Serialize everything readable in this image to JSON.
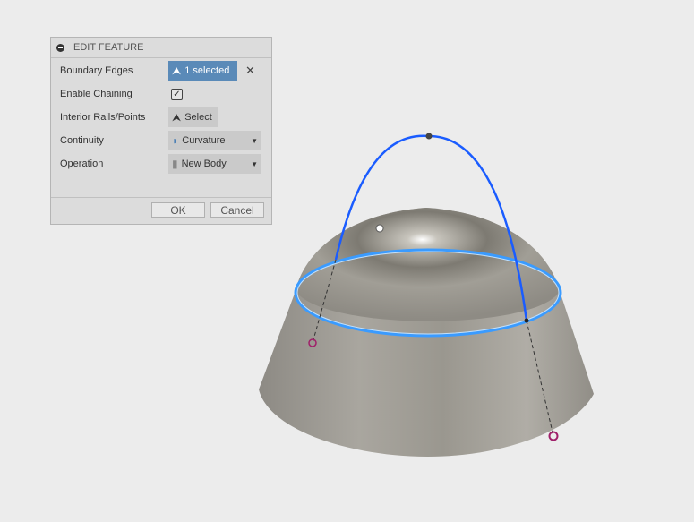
{
  "dialog": {
    "title": "EDIT FEATURE",
    "rows": [
      {
        "label": "Boundary Edges",
        "value": "1 selected"
      },
      {
        "label": "Enable Chaining",
        "checked": true,
        "check_glyph": "✓"
      },
      {
        "label": "Interior Rails/Points",
        "value": "Select"
      },
      {
        "label": "Continuity",
        "value": "Curvature"
      },
      {
        "label": "Operation",
        "value": "New Body"
      }
    ],
    "clear_glyph": "✕",
    "ok_label": "OK",
    "cancel_label": "Cancel"
  },
  "colors": {
    "accent": "#5a8ab8",
    "curve": "#1a5cff",
    "point": "#a0206a"
  }
}
